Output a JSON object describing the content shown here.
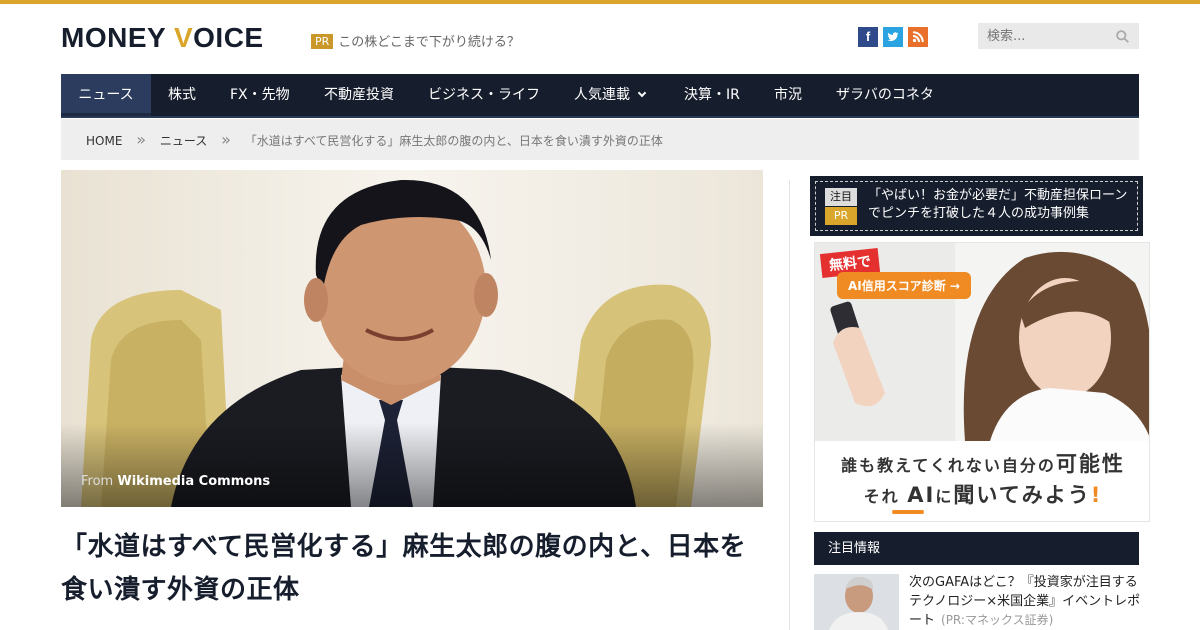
{
  "header": {
    "logo_part1": "MONEY",
    "logo_y": "V",
    "logo_part2": "OICE",
    "pr_badge": "PR",
    "pr_text": "この株どこまで下がり続ける？",
    "social": {
      "facebook": "f",
      "twitter": "t",
      "rss": "≈"
    },
    "search_placeholder": "検索..."
  },
  "nav": {
    "items": [
      {
        "label": "ニュース"
      },
      {
        "label": "株式"
      },
      {
        "label": "FX・先物"
      },
      {
        "label": "不動産投資"
      },
      {
        "label": "ビジネス・ライフ"
      },
      {
        "label": "人気連載"
      },
      {
        "label": "決算・IR"
      },
      {
        "label": "市況"
      },
      {
        "label": "ザラバのコネタ"
      }
    ],
    "active": "ニュース"
  },
  "breadcrumb": {
    "home": "HOME",
    "section": "ニュース",
    "current": "「水道はすべて民営化する」麻生太郎の腹の内と、日本を食い潰す外資の正体",
    "separator": "»"
  },
  "article": {
    "image_credit_prefix": "From",
    "image_credit_source": "Wikimedia Commons",
    "title": "「水道はすべて民営化する」麻生太郎の腹の内と、日本を食い潰す外資の正体"
  },
  "sidebar": {
    "notice": {
      "tag1": "注目",
      "tag2": "PR",
      "text": "「やばい！お金が必要だ」不動産担保ローンでピンチを打破した４人の成功事例集"
    },
    "ad": {
      "free_label": "無料で",
      "cta_label": "AI信用スコア診断 →",
      "line1_pre": "誰も教えてくれない自分の",
      "line1_big": "可能性",
      "line2_pre": "それ",
      "line2_big": "AI",
      "line2_mid": "に",
      "line2_big2": "聞いてみよう",
      "line2_bang": "!"
    },
    "section_title": "注目情報",
    "featured": {
      "title": "次のGAFAはどこ？『投資家が注目するテクノロジー×米国企業』イベントレポート",
      "source": "(PR:マネックス証券)"
    }
  },
  "colors": {
    "accent_gold": "#d9a62b",
    "navy": "#161d2c",
    "nav_active": "#2c3c5e"
  }
}
